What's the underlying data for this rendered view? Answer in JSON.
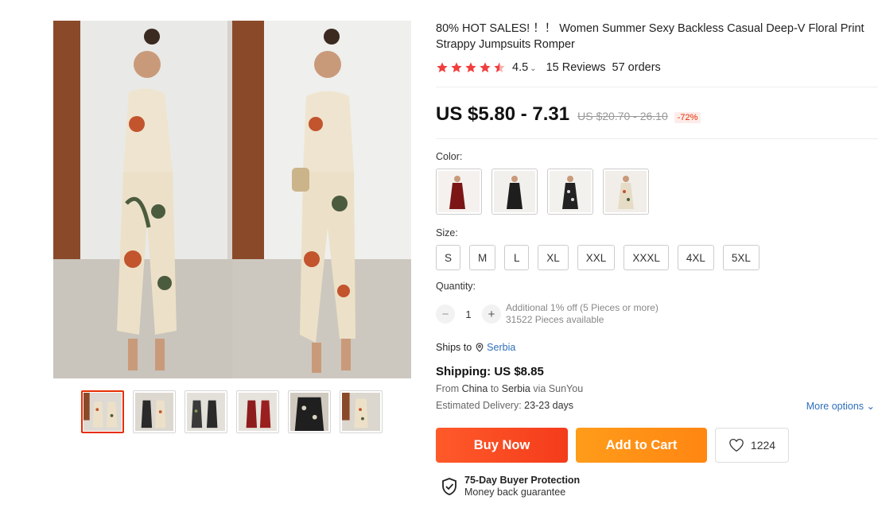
{
  "product": {
    "title": "80% HOT SALES! ！！ Women Summer Sexy Backless Casual Deep-V Floral Print Strappy Jumpsuits Romper",
    "rating": "4.5",
    "reviews": "15 Reviews",
    "orders": "57 orders",
    "stars_filled": 4.5,
    "price": "US $5.80 - 7.31",
    "original_price": "US $20.70 - 26.10",
    "discount": "-72%"
  },
  "gallery": {
    "thumbnails": [
      "floral",
      "black-pair",
      "black-pair-2",
      "red",
      "black-floral",
      "floral-2"
    ],
    "active_index": 0
  },
  "options": {
    "color_label": "Color:",
    "colors": [
      "burgundy",
      "black",
      "black-floral",
      "beige-floral"
    ],
    "size_label": "Size:",
    "sizes": [
      "S",
      "M",
      "L",
      "XL",
      "XXL",
      "XXXL",
      "4XL",
      "5XL"
    ]
  },
  "quantity": {
    "label": "Quantity:",
    "value": "1",
    "minus": "−",
    "plus": "+",
    "note_line1": "Additional 1% off (5 Pieces or more)",
    "note_line2": "31522 Pieces available"
  },
  "shipping": {
    "ships_to_label": "Ships to",
    "ships_to_country": "Serbia",
    "cost": "Shipping: US $8.85",
    "from_prefix": "From",
    "from_country": "China",
    "to_word": "to",
    "to_country": "Serbia",
    "via": "via SunYou",
    "delivery_label": "Estimated Delivery:",
    "delivery_value": "23-23 days",
    "more_options": "More options"
  },
  "actions": {
    "buy_now": "Buy Now",
    "add_to_cart": "Add to Cart",
    "wishlist_count": "1224"
  },
  "protection": {
    "title": "75-Day Buyer Protection",
    "subtitle": "Money back guarantee"
  },
  "colors": {
    "accent": "#e62e04",
    "star": "#f23d3d",
    "link": "#2e6fb9",
    "buy": "#f43c1b",
    "cart": "#ff8612"
  }
}
